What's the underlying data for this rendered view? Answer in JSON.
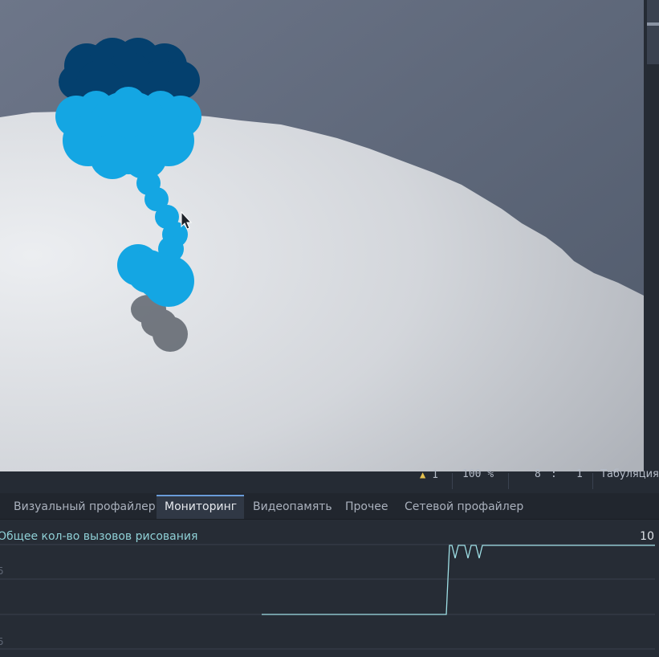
{
  "status": {
    "warning_count": "1",
    "zoom": "100 %",
    "line": "8",
    "column": "1",
    "indent_mode": "Табуляция"
  },
  "tabs": [
    {
      "label": "Визуальный профайлер",
      "active": false
    },
    {
      "label": "Мониторинг",
      "active": true
    },
    {
      "label": "Видеопамять",
      "active": false
    },
    {
      "label": "Прочее",
      "active": false
    },
    {
      "label": "Сетевой профайлер",
      "active": false
    }
  ],
  "monitor": {
    "title": "Общее кол-во вызовов рисования",
    "max_value": "10",
    "grid_labels": [
      "5",
      "5"
    ],
    "line_color": "#9fe0e6"
  },
  "colors": {
    "sky": "#5c6678",
    "ground": "#dfe2e6",
    "creature_light": "#14a6e3",
    "creature_dark": "#04406e",
    "shadow": "#5a606a"
  }
}
